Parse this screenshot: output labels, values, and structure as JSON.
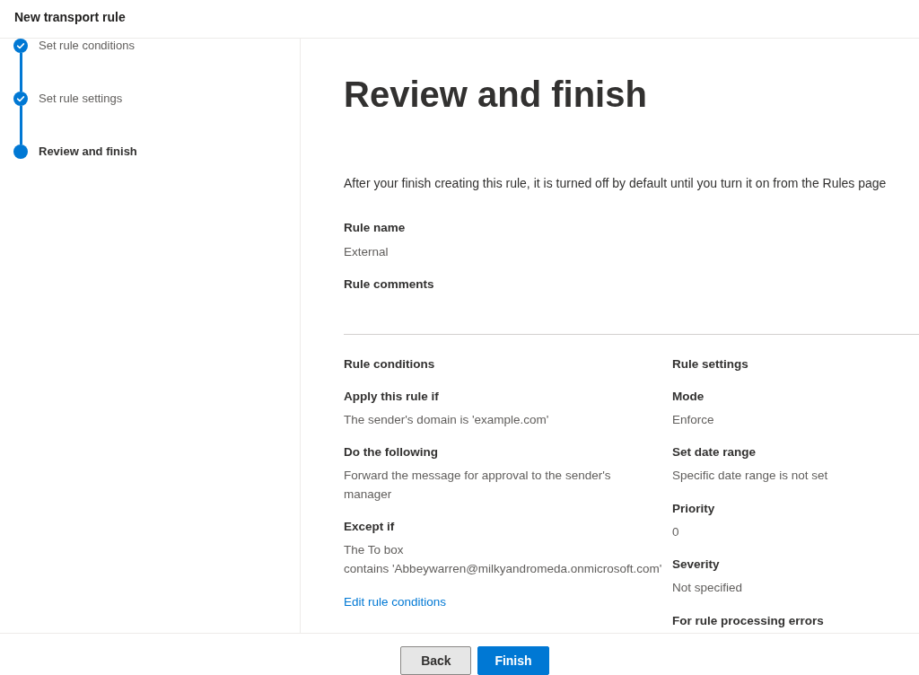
{
  "header": {
    "title": "New transport rule"
  },
  "steps": [
    {
      "label": "Set rule conditions",
      "completed": true,
      "selected": false
    },
    {
      "label": "Set rule settings",
      "completed": true,
      "selected": false
    },
    {
      "label": "Review and finish",
      "completed": false,
      "selected": true
    }
  ],
  "page": {
    "title": "Review and finish",
    "description": "After your finish creating this rule, it is turned off by default until you turn it on from the Rules page"
  },
  "summary": [
    {
      "label": "Rule name",
      "value": "External"
    },
    {
      "label": "Rule comments"
    }
  ],
  "columns": [
    {
      "heading": "Rule conditions",
      "fields": [
        {
          "label": "Apply this rule if",
          "value": "The sender's domain is 'example.com'"
        },
        {
          "label": "Do the following",
          "value": "Forward the message for approval to the sender's manager"
        },
        {
          "label": "Except if",
          "value": "The To box\ncontains 'Abbeywarren@milkyandromeda.onmicrosoft.com'"
        }
      ],
      "link": "Edit rule conditions"
    },
    {
      "heading": "Rule settings",
      "fields": [
        {
          "label": "Mode",
          "value": "Enforce"
        },
        {
          "label": "Set date range",
          "value": "Specific date range is not set"
        },
        {
          "label": "Priority",
          "value": "0"
        },
        {
          "label": "Severity",
          "value": "Not specified"
        },
        {
          "label": "For rule processing errors"
        }
      ]
    }
  ],
  "buttons": [
    {
      "label": "Back",
      "kind": "secondary"
    },
    {
      "label": "Finish",
      "kind": "primary"
    }
  ]
}
